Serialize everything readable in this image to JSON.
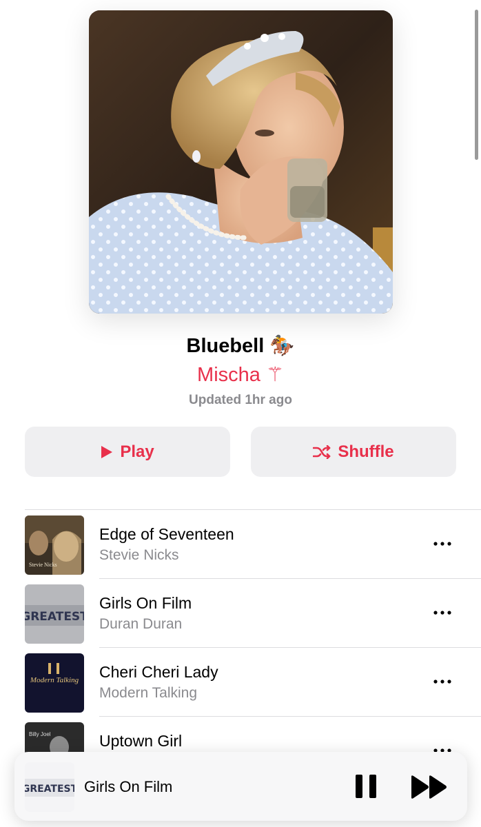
{
  "playlist": {
    "title": "Bluebell",
    "title_emoji": "🏇",
    "owner": "Mischa",
    "owner_glyph": "⚚",
    "updated": "Updated 1hr ago"
  },
  "actions": {
    "play_label": "Play",
    "shuffle_label": "Shuffle",
    "play_icon": "play-icon",
    "shuffle_icon": "shuffle-icon"
  },
  "tracks": [
    {
      "title": "Edge of Seventeen",
      "artist": "Stevie Nicks",
      "art_caption": "Stevie Nicks"
    },
    {
      "title": "Girls On Film",
      "artist": "Duran Duran",
      "art_caption": "GREATEST"
    },
    {
      "title": "Cheri Cheri Lady",
      "artist": "Modern Talking",
      "art_caption": "Modern Talking"
    },
    {
      "title": "Uptown Girl",
      "artist": "",
      "art_caption": "Billy Joel"
    }
  ],
  "now_playing": {
    "title": "Girls On Film",
    "art_caption": "GREATEST",
    "pause_icon": "pause-icon",
    "next_icon": "fast-forward-icon"
  },
  "colors": {
    "accent": "#e8304b",
    "secondary_text": "#8a8a8e",
    "button_bg": "#efeff1"
  }
}
